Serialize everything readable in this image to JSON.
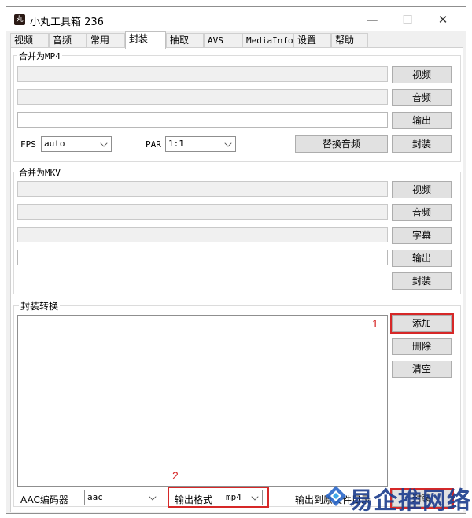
{
  "window": {
    "title": "小丸工具箱 236",
    "app_icon_glyph": "丸",
    "controls": {
      "minimize": "—",
      "maximize": "☐",
      "close": "✕"
    }
  },
  "tabs": [
    "视频",
    "音频",
    "常用",
    "封装",
    "抽取",
    "AVS",
    "MediaInfo",
    "设置",
    "帮助"
  ],
  "active_tab": "封装",
  "mp4_group": {
    "title": "合并为MP4",
    "buttons": {
      "video": "视频",
      "audio": "音频",
      "output": "输出",
      "replace_audio": "替换音频",
      "mux": "封装"
    },
    "fps_label": "FPS",
    "fps_value": "auto",
    "par_label": "PAR",
    "par_value": "1:1"
  },
  "mkv_group": {
    "title": "合并为MKV",
    "buttons": {
      "video": "视频",
      "audio": "音频",
      "subtitle": "字幕",
      "output": "输出",
      "mux": "封装"
    }
  },
  "convert_group": {
    "title": "封装转换",
    "buttons": {
      "add": "添加",
      "delete": "删除",
      "clear": "清空",
      "mux": "封装"
    },
    "aac_label": "AAC编码器",
    "aac_value": "aac",
    "format_label": "输出格式",
    "format_value": "mp4",
    "output_to_label": "输出到原文件目录"
  },
  "annotations": {
    "one": "1",
    "two": "2",
    "color": "#d62828"
  },
  "watermark": {
    "text": "易企推网络",
    "color": "#1f3f8f"
  }
}
